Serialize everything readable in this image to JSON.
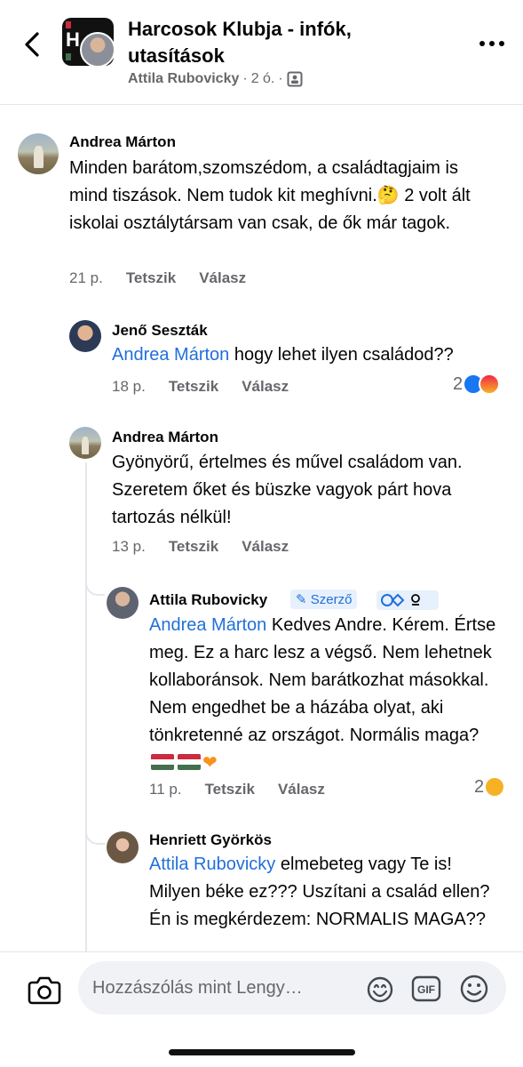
{
  "header": {
    "title": "Harcosok Klubja - infók, utasítások",
    "author": "Attila Rubovicky",
    "time": "2 ó.",
    "separator": "·",
    "group_mark": "H"
  },
  "comments": [
    {
      "author": "Andrea Márton",
      "text": "Minden barátom,szomszédom, a családtagjaim is mind tiszások. Nem tudok kit meghívni.🤔 2 volt ált iskolai osztálytársam van csak, de ők már tagok.",
      "time": "21 p.",
      "like": "Tetszik",
      "reply": "Válasz"
    },
    {
      "author": "Jenő Seszták",
      "mention": "Andrea Márton",
      "text": " hogy lehet ilyen családod??",
      "time": "18 p.",
      "like": "Tetszik",
      "reply": "Válasz",
      "reaction_count": "2"
    },
    {
      "author": "Andrea Márton",
      "text": "Gyönyörű, értelmes és művel családom van. Szeretem őket és büszke vagyok párt hova tartozás nélkül!",
      "time": "13 p.",
      "like": "Tetszik",
      "reply": "Válasz"
    },
    {
      "author": "Attila Rubovicky",
      "badge": "Szerző",
      "mention": "Andrea Márton",
      "text": " Kedves Andre. Kérem. Értse meg. Ez a harc lesz a végső. Nem lehetnek kollaboránsok. Nem barátkozhat másokkal. Nem engedhet be a házába olyat, aki tönkretenné az országot. Normális maga?",
      "time": "11 p.",
      "like": "Tetszik",
      "reply": "Válasz",
      "reaction_count": "2"
    },
    {
      "author": "Henriett Györkös",
      "mention": "Attila Rubovicky",
      "text": " elmebeteg vagy Te is! Milyen béke ez??? Uszítani a család ellen? Én is megkérdezem: NORMALIS MAGA??"
    }
  ],
  "composer": {
    "placeholder": "Hozzászólás mint Lengy…",
    "gif_label": "GIF"
  },
  "colors": {
    "link": "#216fdb",
    "meta": "#65676b",
    "divider": "#e4e6eb",
    "like": "#1877f2"
  },
  "icons": [
    "back-arrow-icon",
    "more-icon",
    "group-privacy-icon",
    "camera-icon",
    "avatar-sticker-icon",
    "gif-icon",
    "emoji-icon"
  ]
}
